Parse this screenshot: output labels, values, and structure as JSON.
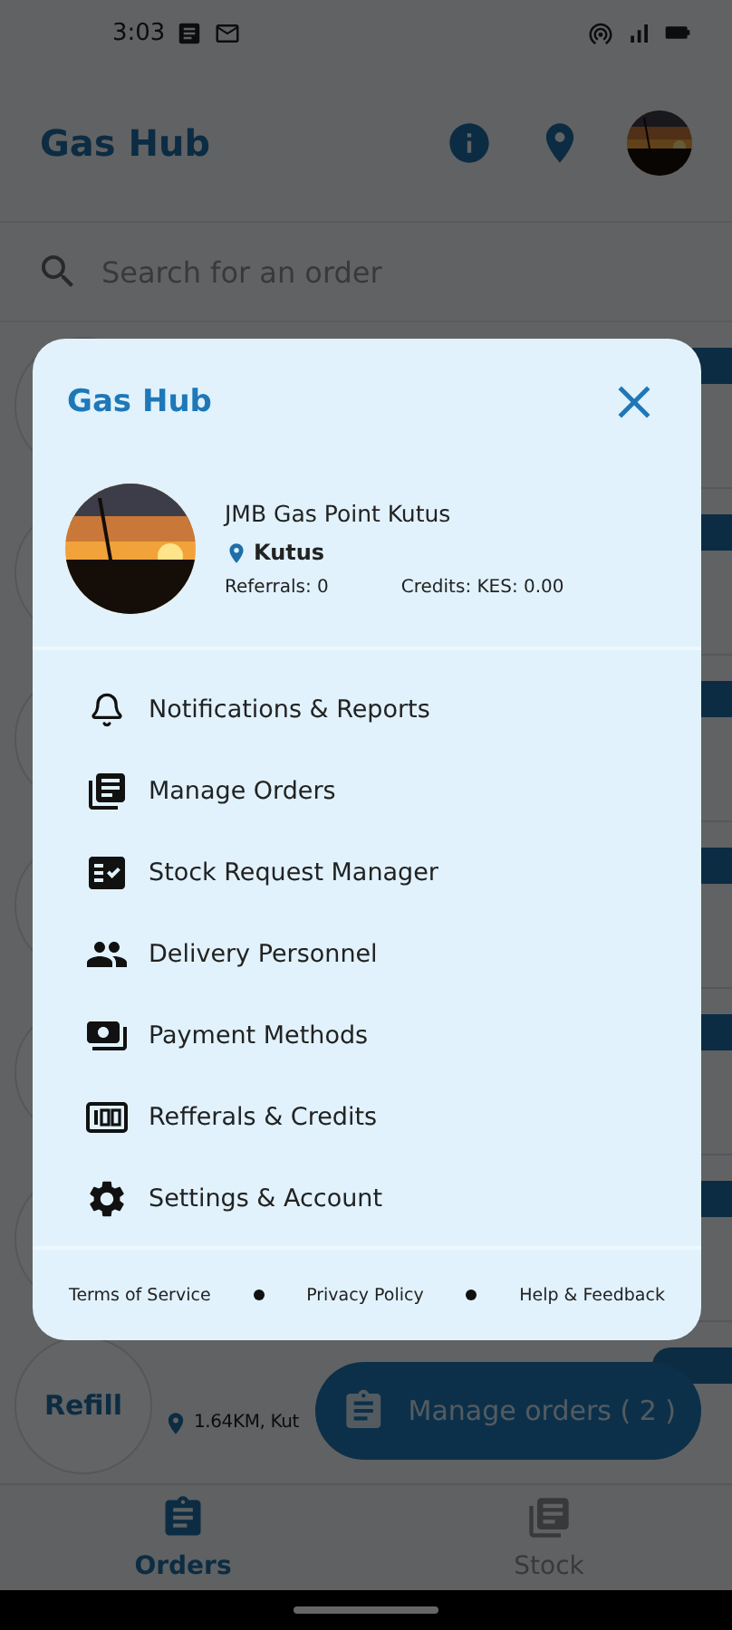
{
  "status_bar": {
    "time": "3:03"
  },
  "app_bar": {
    "title": "Gas Hub"
  },
  "search": {
    "placeholder": "Search for an order"
  },
  "orders": [
    {
      "kind": "hidden"
    },
    {
      "kind": "hidden"
    },
    {
      "kind": "hidden"
    },
    {
      "kind": "hidden"
    },
    {
      "kind": "hidden"
    },
    {
      "kind": "hidden"
    },
    {
      "kind": "visible",
      "avatar_text": "Refill",
      "distance": "1.64KM, Kut"
    }
  ],
  "fab": {
    "label": "Manage orders ( 2 )"
  },
  "bottom_nav": [
    {
      "label": "Orders",
      "selected": true
    },
    {
      "label": "Stock",
      "selected": false
    }
  ],
  "drawer": {
    "title": "Gas Hub",
    "profile": {
      "name": "JMB Gas Point Kutus",
      "location": "Kutus",
      "referrals": "Referrals: 0",
      "credits": "Credits: KES: 0.00"
    },
    "menu": [
      {
        "label": "Notifications & Reports"
      },
      {
        "label": "Manage Orders"
      },
      {
        "label": "Stock Request Manager"
      },
      {
        "label": "Delivery Personnel"
      },
      {
        "label": "Payment Methods"
      },
      {
        "label": "Refferals & Credits"
      },
      {
        "label": "Settings & Account"
      }
    ],
    "footer": [
      "Terms of Service",
      "Privacy Policy",
      "Help & Feedback"
    ]
  }
}
